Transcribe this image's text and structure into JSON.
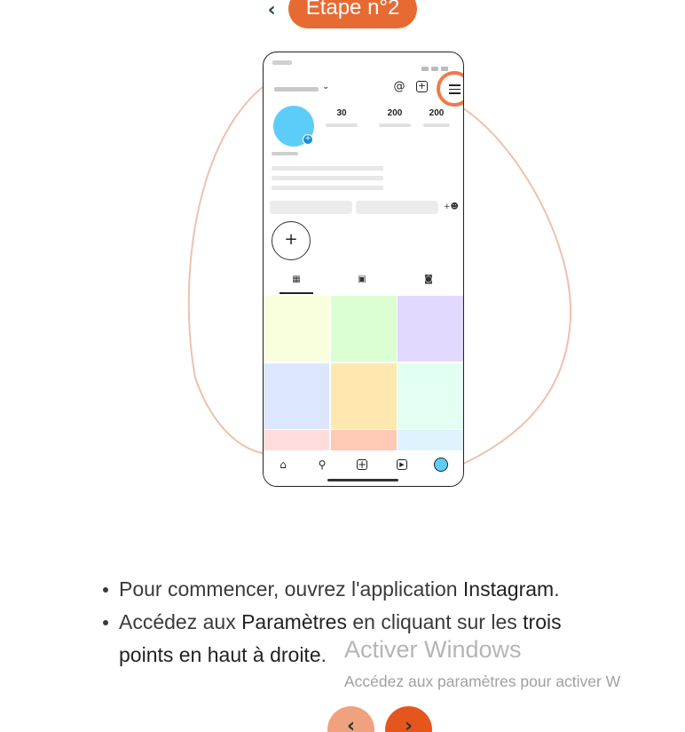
{
  "header": {
    "back_icon": "chevron-left-icon",
    "step_label": "Étape n°2"
  },
  "illustration": {
    "stats": [
      "30",
      "200",
      "200"
    ],
    "colors": {
      "accent": "#ee7b4a",
      "avatar": "#5ccdf9",
      "blob_outline": "#efc1ae"
    },
    "grid_colors": [
      "#f9ffdd",
      "#dcffd2",
      "#e2d9ff",
      "#dde6ff",
      "#ffe8b0",
      "#e2fff1",
      "#ffdcdc",
      "#ffc9b5",
      "#dff3ff"
    ],
    "icons": [
      "threads-icon",
      "plus-box-icon",
      "menu-icon",
      "add-icon",
      "grid-icon",
      "reels-icon",
      "tagged-icon",
      "home-icon",
      "search-icon",
      "create-icon",
      "reels-nav-icon",
      "profile-avatar"
    ],
    "plus_glyph": "+"
  },
  "instructions": [
    {
      "p1": "Pour commencer, ouvrez l'application ",
      "k1": "Instagram",
      "p2": "."
    },
    {
      "p1": "Accédez aux ",
      "k1": "Paramètres",
      "p2": " en cliquant sur les ",
      "k2": "trois",
      "p3": "points en haut à droite",
      "p4": "."
    }
  ],
  "watermark": {
    "title": "Activer Windows",
    "subtitle": "Accédez aux paramètres pour activer W"
  },
  "navigation": {
    "prev_icon": "chevron-left-icon",
    "next_icon": "chevron-right-icon",
    "prev_glyph": "‹",
    "next_glyph": "›"
  }
}
